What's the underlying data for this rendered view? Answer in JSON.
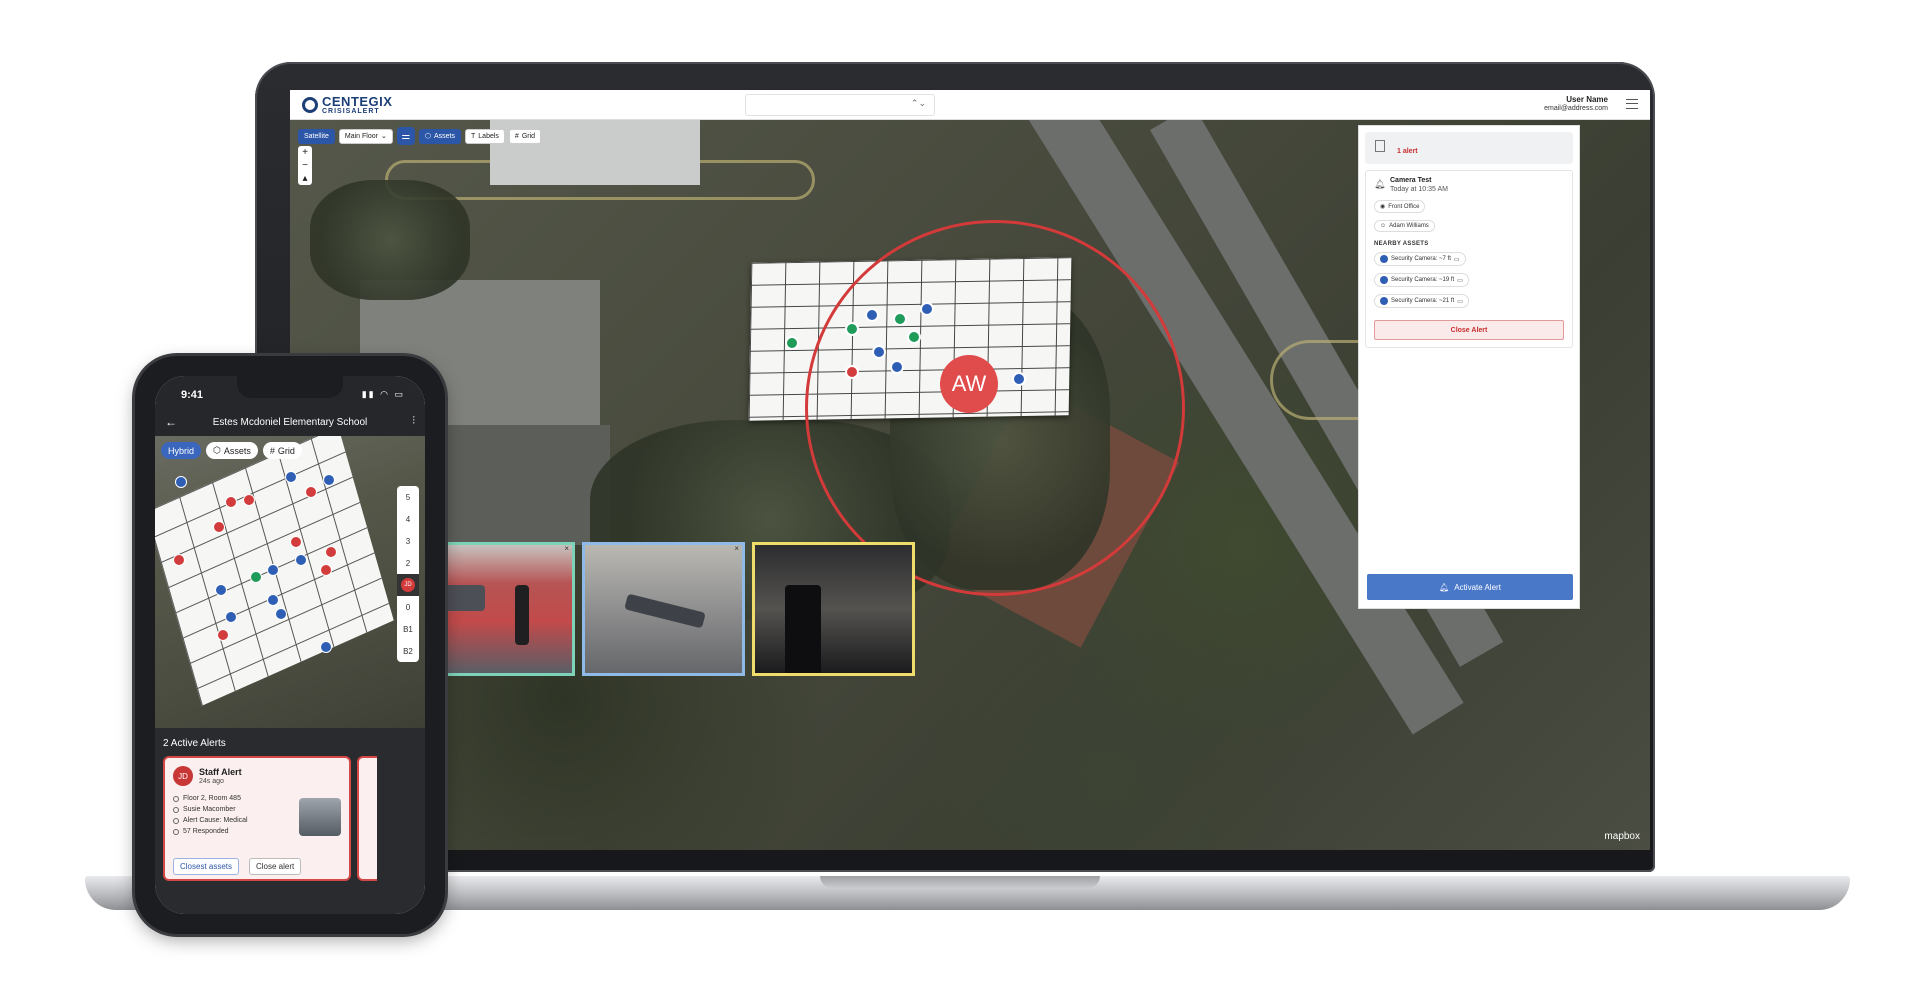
{
  "app": {
    "brand_name": "CENTEGIX",
    "brand_sub": "CRISISALERT",
    "user_name": "User Name",
    "user_email": "email@address.com"
  },
  "toolbar": {
    "satellite": "Satellite",
    "floor": "Main Floor",
    "assets": "Assets",
    "labels": "Labels",
    "grid": "Grid"
  },
  "map": {
    "alert_initials": "AW",
    "attribution": "mapbox"
  },
  "alert_panel": {
    "count": "1 alert",
    "title": "Camera Test",
    "time": "Today at 10:35 AM",
    "location": "Front Office",
    "person": "Adam Williams",
    "nearby_heading": "NEARBY ASSETS",
    "assets": [
      "Security Camera: ~7 ft",
      "Security Camera: ~19 ft",
      "Security Camera: ~21 ft"
    ],
    "close_button": "Close Alert",
    "activate_button": "Activate Alert"
  },
  "phone": {
    "time": "9:41",
    "title": "Estes Mcdoniel Elementary School",
    "toolbar": {
      "hybrid": "Hybrid",
      "assets": "Assets",
      "grid": "Grid"
    },
    "floors": [
      "5",
      "4",
      "3",
      "2",
      "JD",
      "0",
      "B1",
      "B2"
    ],
    "alerts_heading": "2 Active Alerts",
    "alert": {
      "initials": "JD",
      "title": "Staff Alert",
      "time": "24s ago",
      "room": "Floor 2, Room 485",
      "person": "Susie Macomber",
      "cause": "Alert Cause: Medical",
      "responded": "57 Responded",
      "closest_button": "Closest assets",
      "close_button": "Close alert"
    }
  }
}
